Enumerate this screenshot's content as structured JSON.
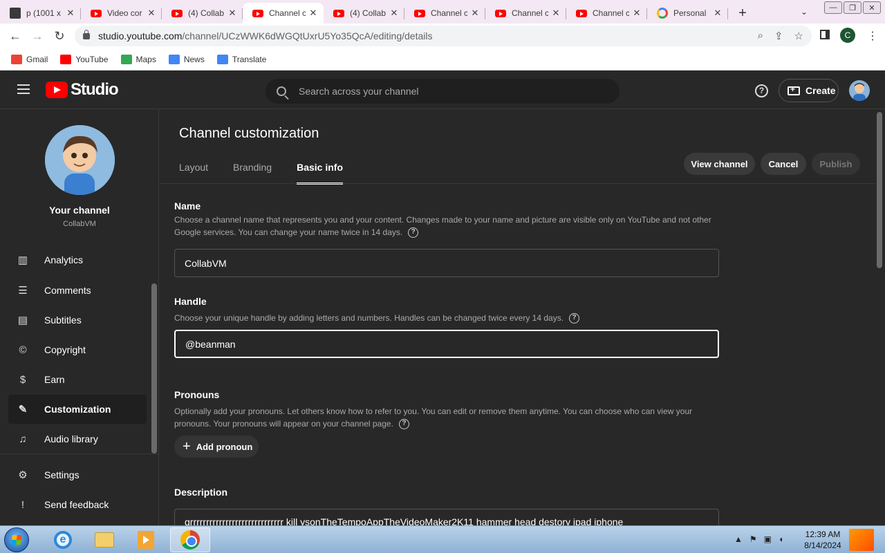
{
  "browser": {
    "tabs": [
      {
        "title": "p (1001 x",
        "favicon": "dark",
        "active": false
      },
      {
        "title": "Video cor",
        "favicon": "youtube",
        "active": false
      },
      {
        "title": "(4) Collab",
        "favicon": "youtube",
        "active": false
      },
      {
        "title": "Channel c",
        "favicon": "youtube",
        "active": true
      },
      {
        "title": "(4) Collab",
        "favicon": "youtube",
        "active": false
      },
      {
        "title": "Channel c",
        "favicon": "youtube",
        "active": false
      },
      {
        "title": "Channel c",
        "favicon": "youtube",
        "active": false
      },
      {
        "title": "Channel c",
        "favicon": "youtube",
        "active": false
      },
      {
        "title": "Personal",
        "favicon": "google",
        "active": false
      }
    ],
    "url_host": "studio.youtube.com",
    "url_path": "/channel/UCzWWK6dWGQtUxrU5Yo35QcA/editing/details",
    "profile_initial": "C",
    "bookmarks": [
      {
        "label": "Gmail",
        "color": "#ea4335"
      },
      {
        "label": "YouTube",
        "color": "#ff0000"
      },
      {
        "label": "Maps",
        "color": "#34a853"
      },
      {
        "label": "News",
        "color": "#4285f4"
      },
      {
        "label": "Translate",
        "color": "#4285f4"
      }
    ]
  },
  "studio": {
    "logo_text": "Studio",
    "search_placeholder": "Search across your channel",
    "create_label": "Create"
  },
  "sidebar": {
    "channel_title": "Your channel",
    "channel_name": "CollabVM",
    "items": [
      {
        "label": "Analytics",
        "icon": "analytics-icon",
        "glyph": "▥"
      },
      {
        "label": "Comments",
        "icon": "comments-icon",
        "glyph": "☰"
      },
      {
        "label": "Subtitles",
        "icon": "subtitles-icon",
        "glyph": "▤"
      },
      {
        "label": "Copyright",
        "icon": "copyright-icon",
        "glyph": "©"
      },
      {
        "label": "Earn",
        "icon": "earn-icon",
        "glyph": "$"
      },
      {
        "label": "Customization",
        "icon": "customization-icon",
        "glyph": "✎"
      },
      {
        "label": "Audio library",
        "icon": "audio-library-icon",
        "glyph": "♫"
      },
      {
        "label": "Settings",
        "icon": "settings-icon",
        "glyph": "⚙"
      },
      {
        "label": "Send feedback",
        "icon": "feedback-icon",
        "glyph": "!"
      }
    ]
  },
  "main": {
    "title": "Channel customization",
    "tabs": [
      "Layout",
      "Branding",
      "Basic info"
    ],
    "view_channel_label": "View channel",
    "cancel_label": "Cancel",
    "publish_label": "Publish",
    "name": {
      "label": "Name",
      "description": "Choose a channel name that represents you and your content. Changes made to your name and picture are visible only on YouTube and not other Google services. You can change your name twice in 14 days.",
      "value": "CollabVM"
    },
    "handle": {
      "label": "Handle",
      "description": "Choose your unique handle by adding letters and numbers. Handles can be changed twice every 14 days.",
      "value": "@beanman"
    },
    "pronouns": {
      "label": "Pronouns",
      "description": "Optionally add your pronouns. Let others know how to refer to you. You can edit or remove them anytime. You can choose who can view your pronouns. Your pronouns will appear on your channel page.",
      "add_label": "Add pronoun"
    },
    "description": {
      "label": "Description",
      "value": "grrrrrrrrrrrrrrrrrrrrrrrrrrrrr kill ysonTheTempoAppTheVideoMaker2K11  hammer head destory ipad iphone"
    }
  },
  "taskbar": {
    "time": "12:39 AM",
    "date": "8/14/2024"
  }
}
